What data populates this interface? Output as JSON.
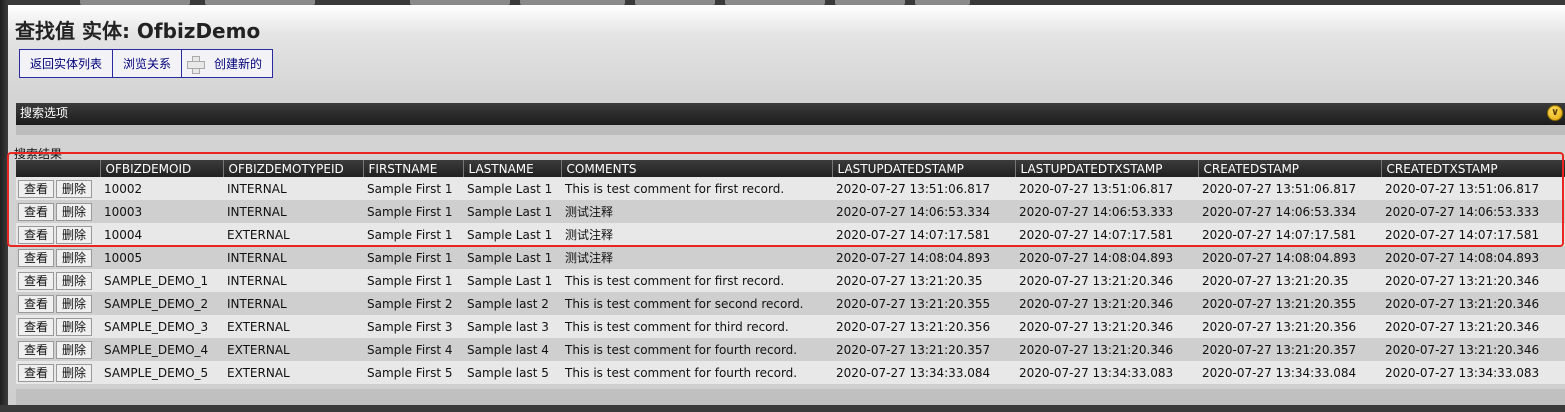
{
  "header": {
    "title": "查找值 实体: OfbizDemo"
  },
  "buttons": {
    "back_to_entity_list": "返回实体列表",
    "browse_relations": "浏览关系",
    "create_new": "创建新的"
  },
  "search_options": {
    "label": "搜索选项"
  },
  "results": {
    "label": "搜索结果",
    "view_label": "查看",
    "delete_label": "删除",
    "columns": [
      "",
      "OFBIZDEMOID",
      "OFBIZDEMOTYPEID",
      "FIRSTNAME",
      "LASTNAME",
      "COMMENTS",
      "LASTUPDATEDSTAMP",
      "LASTUPDATEDTXSTAMP",
      "CREATEDSTAMP",
      "CREATEDTXSTAMP"
    ],
    "rows": [
      [
        "10002",
        "INTERNAL",
        "Sample First 1",
        "Sample Last 1",
        "This is test comment for first record.",
        "2020-07-27 13:51:06.817",
        "2020-07-27 13:51:06.817",
        "2020-07-27 13:51:06.817",
        "2020-07-27 13:51:06.817"
      ],
      [
        "10003",
        "INTERNAL",
        "Sample First 1",
        "Sample Last 1",
        "测试注释",
        "2020-07-27 14:06:53.334",
        "2020-07-27 14:06:53.333",
        "2020-07-27 14:06:53.334",
        "2020-07-27 14:06:53.333"
      ],
      [
        "10004",
        "EXTERNAL",
        "Sample First 1",
        "Sample Last 1",
        "测试注释",
        "2020-07-27 14:07:17.581",
        "2020-07-27 14:07:17.581",
        "2020-07-27 14:07:17.581",
        "2020-07-27 14:07:17.581"
      ],
      [
        "10005",
        "INTERNAL",
        "Sample First 1",
        "Sample Last 1",
        "测试注释",
        "2020-07-27 14:08:04.893",
        "2020-07-27 14:08:04.893",
        "2020-07-27 14:08:04.893",
        "2020-07-27 14:08:04.893"
      ],
      [
        "SAMPLE_DEMO_1",
        "INTERNAL",
        "Sample First 1",
        "Sample Last 1",
        "This is test comment for first record.",
        "2020-07-27 13:21:20.35",
        "2020-07-27 13:21:20.346",
        "2020-07-27 13:21:20.35",
        "2020-07-27 13:21:20.346"
      ],
      [
        "SAMPLE_DEMO_2",
        "INTERNAL",
        "Sample First 2",
        "Sample last 2",
        "This is test comment for second record.",
        "2020-07-27 13:21:20.355",
        "2020-07-27 13:21:20.346",
        "2020-07-27 13:21:20.355",
        "2020-07-27 13:21:20.346"
      ],
      [
        "SAMPLE_DEMO_3",
        "EXTERNAL",
        "Sample First 3",
        "Sample last 3",
        "This is test comment for third record.",
        "2020-07-27 13:21:20.356",
        "2020-07-27 13:21:20.346",
        "2020-07-27 13:21:20.356",
        "2020-07-27 13:21:20.346"
      ],
      [
        "SAMPLE_DEMO_4",
        "EXTERNAL",
        "Sample First 4",
        "Sample last 4",
        "This is test comment for fourth record.",
        "2020-07-27 13:21:20.357",
        "2020-07-27 13:21:20.346",
        "2020-07-27 13:21:20.357",
        "2020-07-27 13:21:20.346"
      ],
      [
        "SAMPLE_DEMO_5",
        "EXTERNAL",
        "Sample First 5",
        "Sample last 5",
        "This is test comment for fourth record.",
        "2020-07-27 13:34:33.084",
        "2020-07-27 13:34:33.083",
        "2020-07-27 13:34:33.084",
        "2020-07-27 13:34:33.083"
      ]
    ]
  },
  "colors": {
    "header_bar": "#202020",
    "button_border": "#2a2aa0",
    "highlight_box": "#e8261f",
    "row_odd": "#e8e8e8",
    "row_even": "#cfcfcf"
  },
  "icons": {
    "expand": "chevron-down-circle-icon",
    "create": "plus-icon"
  }
}
